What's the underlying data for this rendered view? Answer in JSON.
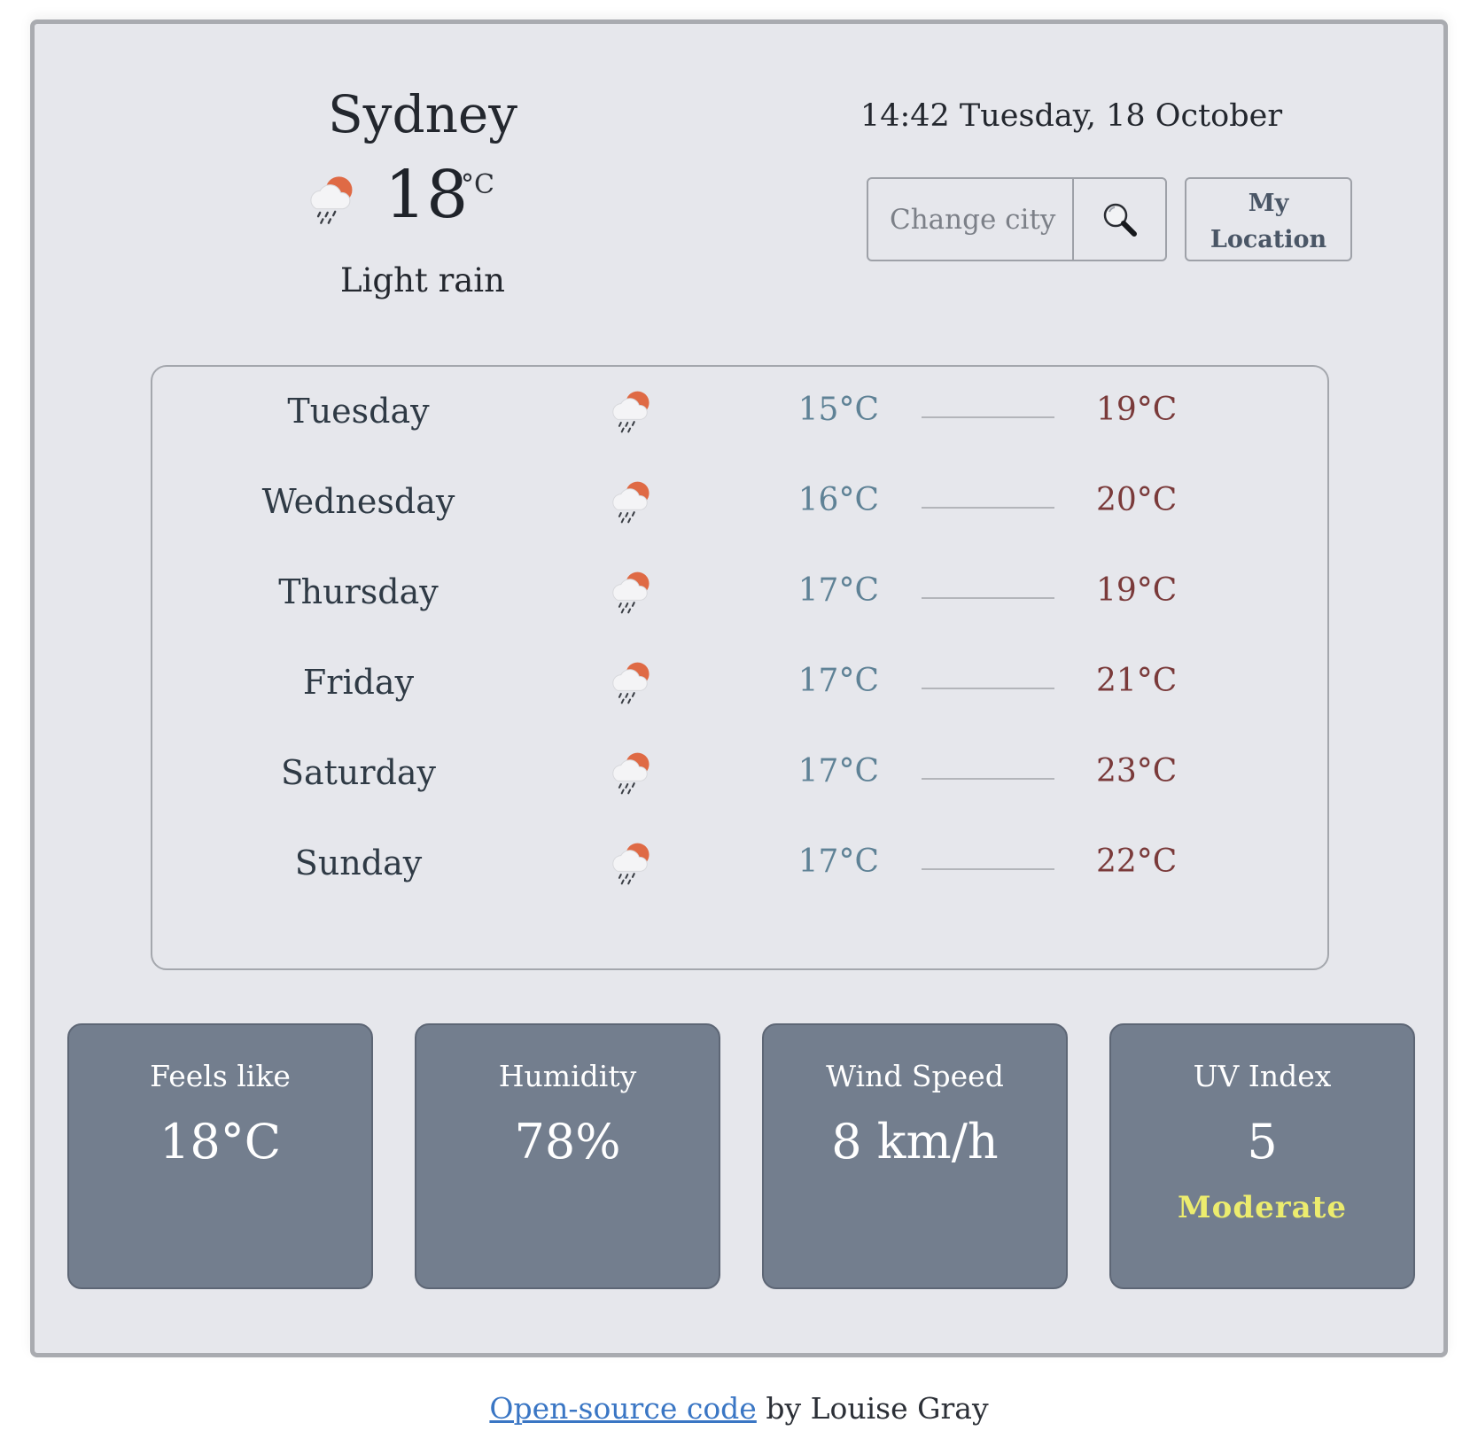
{
  "current": {
    "city": "Sydney",
    "temperature": "18",
    "unit": "°C",
    "description": "Light rain",
    "icon": "light-rain-sun-icon"
  },
  "datetime": "14:42 Tuesday, 18 October",
  "search": {
    "placeholder": "Change city",
    "button_icon": "search-icon"
  },
  "location_button": {
    "line1": "My",
    "line2": "Location"
  },
  "forecast": [
    {
      "day": "Tuesday",
      "min": "15°C",
      "max": "19°C"
    },
    {
      "day": "Wednesday",
      "min": "16°C",
      "max": "20°C"
    },
    {
      "day": "Thursday",
      "min": "17°C",
      "max": "19°C"
    },
    {
      "day": "Friday",
      "min": "17°C",
      "max": "21°C"
    },
    {
      "day": "Saturday",
      "min": "17°C",
      "max": "23°C"
    },
    {
      "day": "Sunday",
      "min": "17°C",
      "max": "22°C"
    }
  ],
  "stats": {
    "feels_like": {
      "label": "Feels like",
      "value": "18°C"
    },
    "humidity": {
      "label": "Humidity",
      "value": "78%"
    },
    "wind": {
      "label": "Wind Speed",
      "value": "8 km/h"
    },
    "uv": {
      "label": "UV Index",
      "value": "5",
      "level": "Moderate"
    }
  },
  "footer": {
    "link_text": "Open-source code",
    "suffix": " by Louise Gray"
  },
  "colors": {
    "card_background": "#e6e7ec",
    "tile_background": "#737e8e",
    "min_temp": "#5f8296",
    "max_temp": "#7a3a3a",
    "uv_level": "#ecec6e",
    "link": "#3a76c4"
  }
}
